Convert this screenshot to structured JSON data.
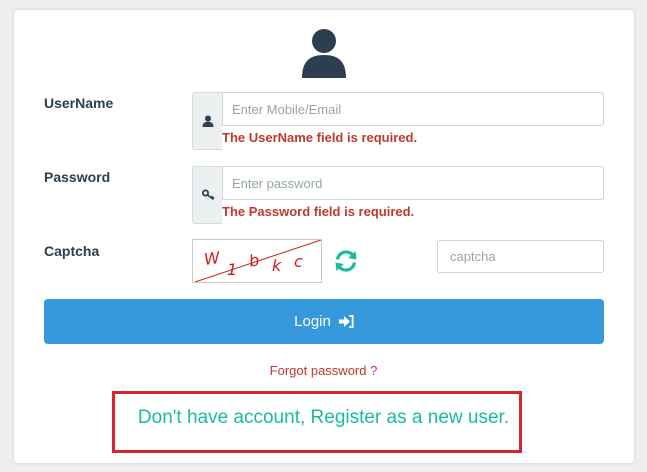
{
  "form": {
    "username": {
      "label": "UserName",
      "placeholder": "Enter Mobile/Email",
      "value": "",
      "error": "The UserName field is required.",
      "icon": "user-icon"
    },
    "password": {
      "label": "Password",
      "placeholder": "Enter password",
      "value": "",
      "error": "The Password field is required.",
      "icon": "key-icon"
    },
    "captcha": {
      "label": "Captcha",
      "image_chars": [
        "W",
        "1",
        "b",
        "k",
        "c"
      ],
      "placeholder": "captcha",
      "value": "",
      "refresh_icon": "refresh-icon"
    },
    "login_label": "Login",
    "login_icon": "sign-in-icon",
    "forgot_label": "Forgot password ?",
    "register_label": "Don't have account, Register as a new user."
  },
  "colors": {
    "primary": "#3498db",
    "danger": "#c0392b",
    "success": "#18bc9c",
    "heading": "#2c3e50",
    "highlight_border": "#d9232d"
  }
}
